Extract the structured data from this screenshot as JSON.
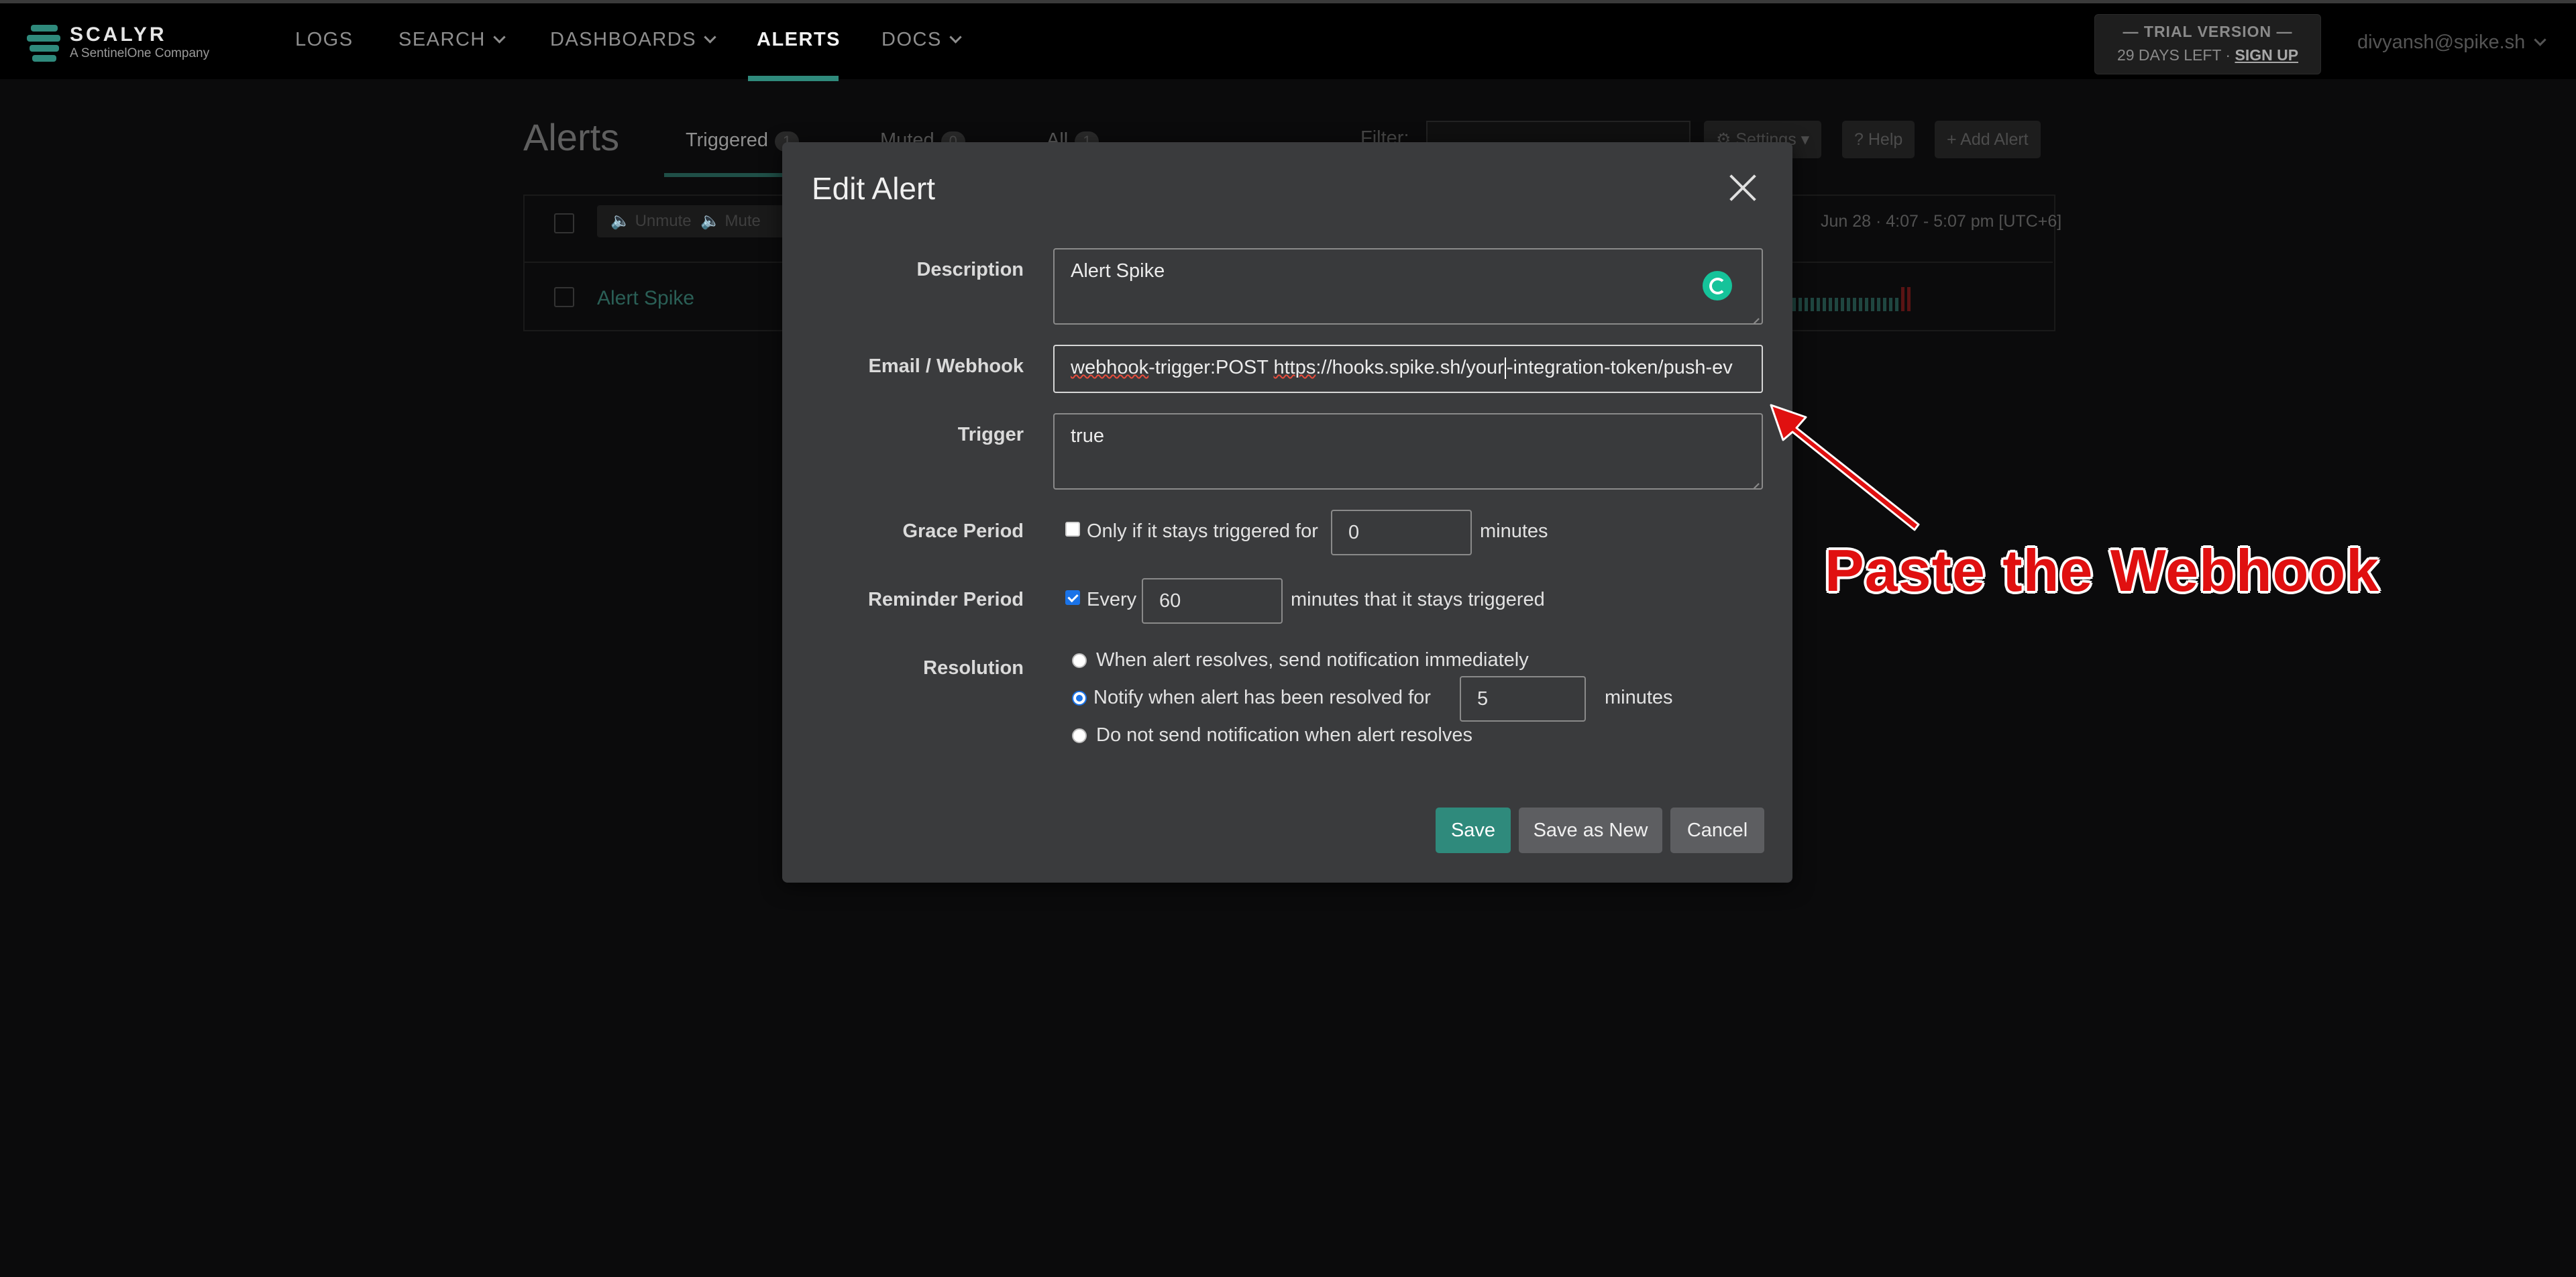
{
  "nav": {
    "logo_name": "SCALYR",
    "logo_sub": "A SentinelOne Company",
    "items": [
      {
        "label": "LOGS"
      },
      {
        "label": "SEARCH"
      },
      {
        "label": "DASHBOARDS"
      },
      {
        "label": "ALERTS"
      },
      {
        "label": "DOCS"
      }
    ],
    "trial_title": "— TRIAL VERSION —",
    "trial_days": "29 DAYS LEFT ·",
    "trial_signup": "SIGN UP",
    "user_email": "divyansh@spike.sh"
  },
  "background_page": {
    "title": "Alerts",
    "tabs": [
      {
        "label": "Triggered",
        "count": "1"
      },
      {
        "label": "Muted",
        "count": "0"
      },
      {
        "label": "All",
        "count": "1"
      }
    ],
    "filter_label": "Filter:",
    "settings_label": "Settings",
    "help_label": "Help",
    "add_alert_label": "Add Alert",
    "unmute_label": "Unmute",
    "mute_label": "Mute",
    "date_range": "Jun 28 · 4:07 - 5:07 pm [UTC+6]",
    "alert_row_name": "Alert Spike"
  },
  "modal": {
    "title": "Edit Alert",
    "description_label": "Description",
    "description_value": "Alert Spike",
    "webhook_label": "Email / Webhook",
    "webhook_part1": "webhook",
    "webhook_part2": "-trigger:POST ",
    "webhook_part3": "https",
    "webhook_part4": "://hooks.spike.sh/your",
    "webhook_part5": "-integration-token/push-ev",
    "trigger_label": "Trigger",
    "trigger_value": "true",
    "grace_label": "Grace Period",
    "grace_checkbox_label": "Only if it stays triggered for",
    "grace_checked": false,
    "grace_value": "0",
    "grace_unit": "minutes",
    "reminder_label": "Reminder Period",
    "reminder_checkbox_label": "Every",
    "reminder_checked": true,
    "reminder_value": "60",
    "reminder_unit": "minutes that it stays triggered",
    "resolution_label": "Resolution",
    "resolution_options": [
      {
        "label": "When alert resolves, send notification immediately",
        "selected": false
      },
      {
        "label": "Notify when alert has been resolved for",
        "selected": true
      },
      {
        "label": "Do not send notification when alert resolves",
        "selected": false
      }
    ],
    "resolution_value": "5",
    "resolution_unit": "minutes",
    "save_label": "Save",
    "save_new_label": "Save as New",
    "cancel_label": "Cancel"
  },
  "annotation": {
    "text": "Paste the Webhook",
    "color": "#e01010"
  },
  "colors": {
    "accent": "#2f8a7c",
    "modal_bg": "#3a3b3d",
    "page_bg": "#0b0b0c"
  }
}
